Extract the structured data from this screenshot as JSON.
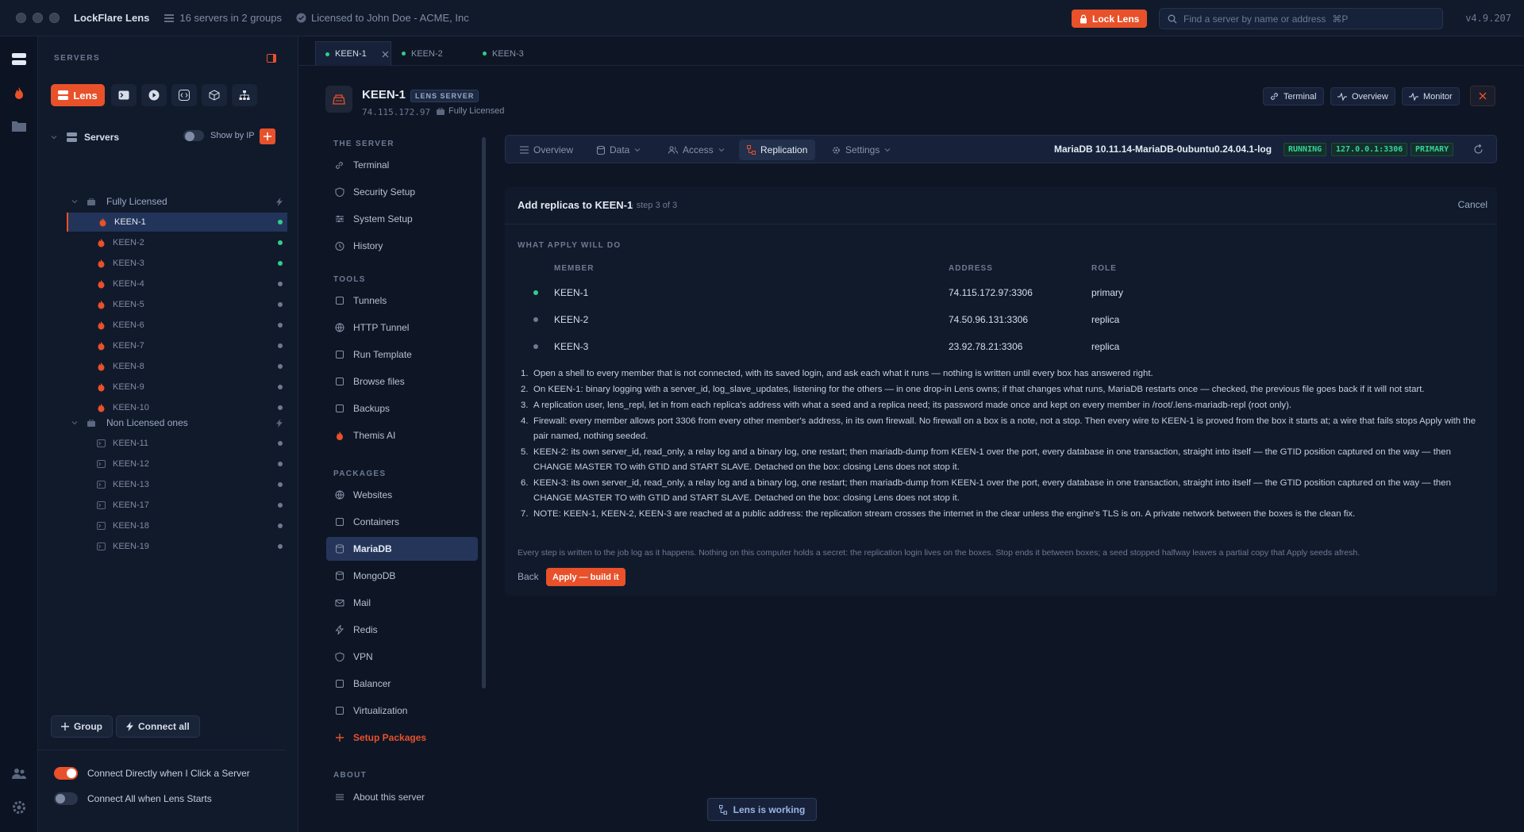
{
  "titlebar": {
    "app_name": "LockFlare Lens",
    "servers_summary": "16 servers in 2 groups",
    "license": "Licensed to John Doe - ACME, Inc",
    "lock_label": "Lock Lens",
    "search_placeholder": "Find a server by name or address",
    "search_shortcut": "⌘P",
    "version": "v4.9.207"
  },
  "sidebar": {
    "title": "SERVERS",
    "lens_tool": "Lens",
    "root": "Servers",
    "show_by_ip": "Show by IP",
    "groups": [
      {
        "name": "Fully Licensed",
        "servers": [
          "KEEN-1",
          "KEEN-2",
          "KEEN-3",
          "KEEN-4",
          "KEEN-5",
          "KEEN-6",
          "KEEN-7",
          "KEEN-8",
          "KEEN-9",
          "KEEN-10"
        ]
      },
      {
        "name": "Non Licensed ones",
        "servers": [
          "KEEN-11",
          "KEEN-12",
          "KEEN-13",
          "KEEN-17",
          "KEEN-18",
          "KEEN-19"
        ]
      }
    ],
    "group_button": "Group",
    "connect_all_button": "Connect all",
    "toggle_connect_direct": "Connect Directly when I Click a Server",
    "toggle_connect_all": "Connect All when Lens Starts"
  },
  "tabs": [
    "KEEN-1",
    "KEEN-2",
    "KEEN-3"
  ],
  "header": {
    "name": "KEEN-1",
    "badge": "LENS SERVER",
    "ip": "74.115.172.97",
    "license": "Fully Licensed",
    "terminal": "Terminal",
    "overview": "Overview",
    "monitor": "Monitor"
  },
  "nav": {
    "the_server": "THE SERVER",
    "tools": "TOOLS",
    "packages": "PACKAGES",
    "about": "ABOUT",
    "server_items": [
      "Terminal",
      "Security Setup",
      "System Setup",
      "History"
    ],
    "tool_items": [
      "Tunnels",
      "HTTP Tunnel",
      "Run Template",
      "Browse files",
      "Backups",
      "Themis AI"
    ],
    "package_items": [
      "Websites",
      "Containers",
      "MariaDB",
      "MongoDB",
      "Mail",
      "Redis",
      "VPN",
      "Balancer",
      "Virtualization",
      "Setup Packages"
    ],
    "about_items": [
      "About this server"
    ]
  },
  "content_tabs": {
    "overview": "Overview",
    "data": "Data",
    "access": "Access",
    "replication": "Replication",
    "settings": "Settings",
    "db_version": "MariaDB 10.11.14-MariaDB-0ubuntu0.24.04.1-log",
    "status": "RUNNING",
    "endpoint": "127.0.0.1:3306",
    "role": "PRIMARY"
  },
  "wizard": {
    "title": "Add replicas to KEEN-1",
    "step": "· step 3 of 3",
    "cancel": "Cancel",
    "section": "WHAT APPLY WILL DO",
    "col_member": "MEMBER",
    "col_address": "ADDRESS",
    "col_role": "ROLE",
    "members": [
      {
        "name": "KEEN-1",
        "address": "74.115.172.97:3306",
        "role": "primary"
      },
      {
        "name": "KEEN-2",
        "address": "74.50.96.131:3306",
        "role": "replica"
      },
      {
        "name": "KEEN-3",
        "address": "23.92.78.21:3306",
        "role": "replica"
      }
    ],
    "steps": [
      "Open a shell to every member that is not connected, with its saved login, and ask each what it runs — nothing is written until every box has answered right.",
      "On KEEN-1: binary logging with a server_id, log_slave_updates, listening for the others — in one drop-in Lens owns; if that changes what runs, MariaDB restarts once — checked, the previous file goes back if it will not start.",
      "A replication user, lens_repl, let in from each replica's address with what a seed and a replica need; its password made once and kept on every member in /root/.lens-mariadb-repl (root only).",
      "Firewall: every member allows port 3306 from every other member's address, in its own firewall. No firewall on a box is a note, not a stop. Then every wire to KEEN-1 is proved from the box it starts at; a wire that fails stops Apply with the pair named, nothing seeded.",
      "KEEN-2: its own server_id, read_only, a relay log and a binary log, one restart; then mariadb-dump from KEEN-1 over the port, every database in one transaction, straight into itself — the GTID position captured on the way — then CHANGE MASTER TO with GTID and START SLAVE. Detached on the box: closing Lens does not stop it.",
      "KEEN-3: its own server_id, read_only, a relay log and a binary log, one restart; then mariadb-dump from KEEN-1 over the port, every database in one transaction, straight into itself — the GTID position captured on the way — then CHANGE MASTER TO with GTID and START SLAVE. Detached on the box: closing Lens does not stop it.",
      "NOTE: KEEN-1, KEEN-2, KEEN-3 are reached at a public address: the replication stream crosses the internet in the clear unless the engine's TLS is on. A private network between the boxes is the clean fix."
    ],
    "note": "Every step is written to the job log as it happens. Nothing on this computer holds a secret: the replication login lives on the boxes. Stop ends it between boxes; a seed stopped halfway leaves a partial copy that Apply seeds afresh.",
    "back": "Back",
    "apply": "Apply — build it"
  },
  "status": {
    "working": "Lens is working"
  },
  "colors": {
    "accent": "#e8512a",
    "online": "#2fcf8a",
    "bg": "#0e1626"
  }
}
